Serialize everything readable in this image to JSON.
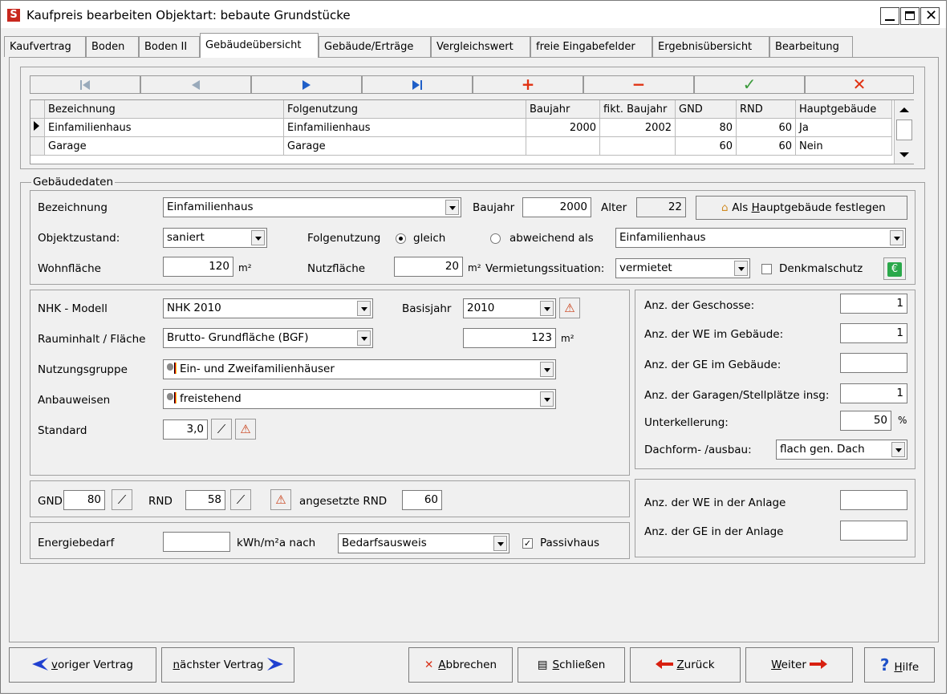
{
  "window": {
    "title": "Kaufpreis bearbeiten  Objektart: bebaute Grundstücke",
    "app_icon_letter": "S"
  },
  "tabs": [
    {
      "label": "Kaufvertrag"
    },
    {
      "label": "Boden"
    },
    {
      "label": "Boden II"
    },
    {
      "label": "Gebäudeübersicht"
    },
    {
      "label": "Gebäude/Erträge"
    },
    {
      "label": "Vergleichswert"
    },
    {
      "label": "freie Eingabefelder"
    },
    {
      "label": "Ergebnisübersicht"
    },
    {
      "label": "Bearbeitung"
    }
  ],
  "nav": {
    "first": "first-record-icon",
    "prev": "prev-record-icon",
    "next": "next-record-icon",
    "last": "last-record-icon",
    "add": "+",
    "remove": "−",
    "confirm": "✓",
    "cancel": "✕"
  },
  "grid": {
    "headers": [
      "Bezeichnung",
      "Folgenutzung",
      "Baujahr",
      "fikt. Baujahr",
      "GND",
      "RND",
      "Hauptgebäude"
    ],
    "rows": [
      [
        "Einfamilienhaus",
        "Einfamilienhaus",
        "2000",
        "2002",
        "80",
        "60",
        "Ja"
      ],
      [
        "Garage",
        "Garage",
        "",
        "",
        "60",
        "60",
        "Nein"
      ]
    ]
  },
  "gebaeudedaten": {
    "group_label": "Gebäudedaten",
    "bezeichnung_label": "Bezeichnung",
    "bezeichnung_value": "Einfamilienhaus",
    "baujahr_label": "Baujahr",
    "baujahr_value": "2000",
    "alter_label": "Alter",
    "alter_value": "22",
    "hauptgebaeude_btn_pre": "Als ",
    "hauptgebaeude_btn_u": "H",
    "hauptgebaeude_btn_post": "auptgebäude festlegen",
    "objektzustand_label": "Objektzustand:",
    "objektzustand_value": "saniert",
    "folgenutzung_label": "Folgenutzung",
    "radio_gleich": "gleich",
    "radio_abweichend": "abweichend  als",
    "folgenutzung_value": "Einfamilienhaus",
    "wohnflaeche_label": "Wohnfläche",
    "wohnflaeche_value": "120",
    "unit_m2": "m²",
    "nutzflaeche_label": "Nutzfläche",
    "nutzflaeche_value": "20",
    "vermietung_label": "Vermietungssituation:",
    "vermietung_value": "vermietet",
    "denkmal_label": "Denkmalschutz"
  },
  "nhk": {
    "modell_label": "NHK - Modell",
    "modell_value": "NHK 2010",
    "basisjahr_label": "Basisjahr",
    "basisjahr_value": "2010",
    "rauminhalt_label": "Rauminhalt / Fläche",
    "rauminhalt_value": "Brutto- Grundfläche (BGF)",
    "flaeche_value": "123",
    "nutzungsgruppe_label": "Nutzungsgruppe",
    "nutzungsgruppe_value": "Ein- und Zweifamilienhäuser",
    "anbauweisen_label": "Anbauweisen",
    "anbauweisen_value": "freistehend",
    "standard_label": "Standard",
    "standard_value": "3,0"
  },
  "right": {
    "geschosse_label": "Anz. der Geschosse:",
    "geschosse_value": "1",
    "we_label": "Anz. der WE im Gebäude:",
    "we_value": "1",
    "ge_label": "Anz. der GE im Gebäude:",
    "ge_value": "",
    "garagen_label": "Anz. der Garagen/Stellplätze insg:",
    "garagen_value": "1",
    "unterkellerung_label": "Unterkellerung:",
    "unterkellerung_value": "50",
    "percent": "%",
    "dachform_label": "Dachform- /ausbau:",
    "dachform_value": "flach gen. Dach",
    "we_anlage_label": "Anz. der WE in der Anlage",
    "we_anlage_value": "",
    "ge_anlage_label": "Anz. der GE in der Anlage",
    "ge_anlage_value": ""
  },
  "nd": {
    "gnd_label": "GND",
    "gnd_value": "80",
    "rnd_label": "RND",
    "rnd_value": "58",
    "angesetzt_label": "angesetzte RND",
    "angesetzt_value": "60"
  },
  "energie": {
    "label": "Energiebedarf",
    "value": "",
    "unit": "kWh/m²a  nach",
    "nach_value": "Bedarfsausweis",
    "passivhaus_label": "Passivhaus"
  },
  "bottom": {
    "voriger_u": "v",
    "voriger_rest": "origer Vertrag",
    "naechster_u": "n",
    "naechster_rest": "ächster Vertrag",
    "abbrechen_u": "A",
    "abbrechen_rest": "bbrechen",
    "schliessen_u": "S",
    "schliessen_rest": "chließen",
    "zurueck_u": "Z",
    "zurueck_rest": "urück",
    "weiter_u": "W",
    "weiter_rest": "eiter",
    "hilfe_u": "H",
    "hilfe_rest": "ilfe"
  }
}
